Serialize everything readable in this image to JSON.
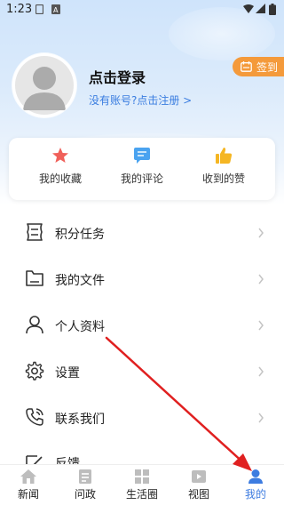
{
  "status_bar": {
    "time": "1:23"
  },
  "profile": {
    "title": "点击登录",
    "register_link": "没有账号?点击注册 >",
    "signin_button": "签到"
  },
  "stats": [
    {
      "label": "我的收藏",
      "icon": "star-icon"
    },
    {
      "label": "我的评论",
      "icon": "comment-icon"
    },
    {
      "label": "收到的赞",
      "icon": "thumbs-up-icon"
    }
  ],
  "menu": [
    {
      "label": "积分任务",
      "icon": "points-task-icon"
    },
    {
      "label": "我的文件",
      "icon": "folder-icon"
    },
    {
      "label": "个人资料",
      "icon": "person-icon"
    },
    {
      "label": "设置",
      "icon": "gear-icon"
    },
    {
      "label": "联系我们",
      "icon": "phone-icon"
    },
    {
      "label": "反馈",
      "icon": "feedback-icon"
    }
  ],
  "bottom_nav": [
    {
      "label": "新闻",
      "icon": "home-icon"
    },
    {
      "label": "问政",
      "icon": "document-icon"
    },
    {
      "label": "生活圈",
      "icon": "grid-icon"
    },
    {
      "label": "视图",
      "icon": "video-icon"
    },
    {
      "label": "我的",
      "icon": "user-icon",
      "active": true
    }
  ],
  "colors": {
    "accent": "#3d7ce0",
    "signin": "#f49a3b",
    "star": "#f0605a",
    "comment": "#4aa3f0",
    "thumb": "#f5b623",
    "arrow": "#e02020"
  }
}
